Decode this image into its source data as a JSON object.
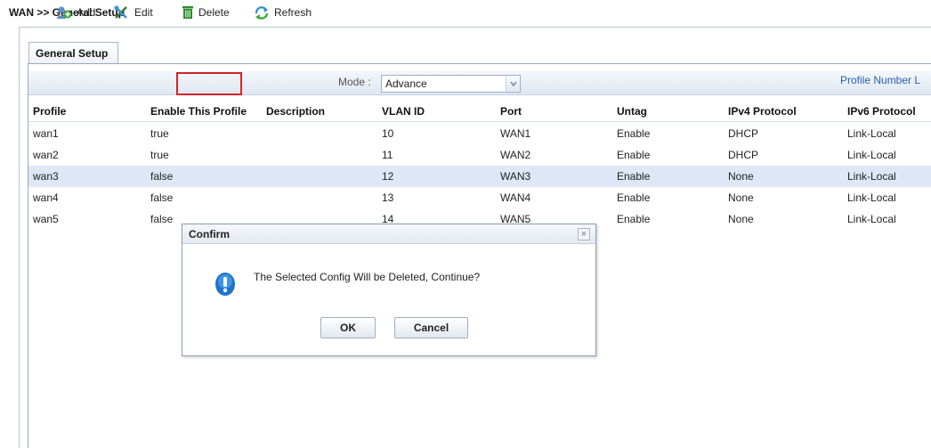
{
  "breadcrumb": "WAN >> General Setup",
  "tab": {
    "label": "General Setup"
  },
  "toolbar": {
    "add_label": "Add",
    "edit_label": "Edit",
    "delete_label": "Delete",
    "refresh_label": "Refresh",
    "mode_label": "Mode :",
    "mode_value": "Advance",
    "profile_limit_label": "Profile Number L"
  },
  "table": {
    "headers": [
      "Profile",
      "Enable This Profile",
      "Description",
      "VLAN ID",
      "Port",
      "Untag",
      "IPv4 Protocol",
      "IPv6 Protocol"
    ],
    "rows": [
      {
        "profile": "wan1",
        "enable": "true",
        "description": "",
        "vlan": "10",
        "port": "WAN1",
        "untag": "Enable",
        "ipv4": "DHCP",
        "ipv6": "Link-Local"
      },
      {
        "profile": "wan2",
        "enable": "true",
        "description": "",
        "vlan": "11",
        "port": "WAN2",
        "untag": "Enable",
        "ipv4": "DHCP",
        "ipv6": "Link-Local"
      },
      {
        "profile": "wan3",
        "enable": "false",
        "description": "",
        "vlan": "12",
        "port": "WAN3",
        "untag": "Enable",
        "ipv4": "None",
        "ipv6": "Link-Local"
      },
      {
        "profile": "wan4",
        "enable": "false",
        "description": "",
        "vlan": "13",
        "port": "WAN4",
        "untag": "Enable",
        "ipv4": "None",
        "ipv6": "Link-Local"
      },
      {
        "profile": "wan5",
        "enable": "false",
        "description": "",
        "vlan": "14",
        "port": "WAN5",
        "untag": "Enable",
        "ipv4": "None",
        "ipv6": "Link-Local"
      }
    ]
  },
  "dialog": {
    "title": "Confirm",
    "close_glyph": "×",
    "message": "The Selected Config Will be Deleted, Continue?",
    "ok_label": "OK",
    "cancel_label": "Cancel"
  },
  "icons": {
    "add": "add-icon",
    "edit": "edit-icon",
    "delete": "trash-icon",
    "refresh": "refresh-icon",
    "dialog": "exclamation-icon"
  },
  "colors": {
    "delete_highlight": "#d2232a",
    "selected_row": "#dde7f5",
    "dialog_icon": "#1e73c8"
  }
}
